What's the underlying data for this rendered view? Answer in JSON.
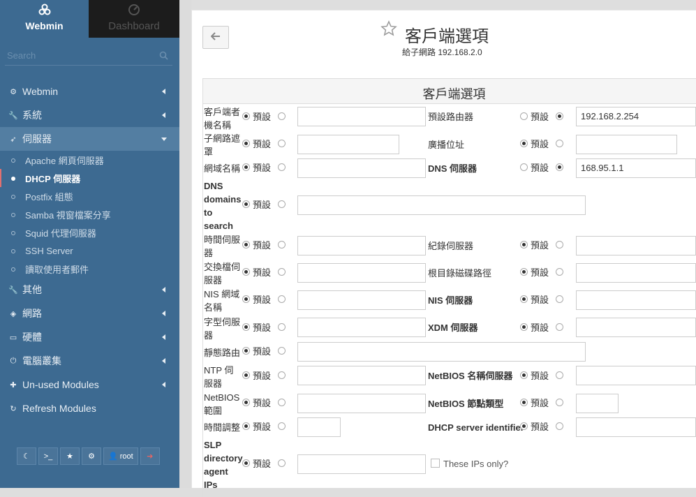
{
  "sidebar": {
    "tab_webmin": "Webmin",
    "tab_dashboard": "Dashboard",
    "search_placeholder": "Search",
    "nav": [
      {
        "label": "Webmin",
        "icon": "gear-icon"
      },
      {
        "label": "系統",
        "icon": "wrench-icon"
      },
      {
        "label": "伺服器",
        "icon": "rocket-icon"
      },
      {
        "label": "其他",
        "icon": "wrench-icon"
      },
      {
        "label": "網路",
        "icon": "shield-icon"
      },
      {
        "label": "硬體",
        "icon": "hdd-icon"
      },
      {
        "label": "電腦叢集",
        "icon": "power-icon"
      },
      {
        "label": "Un-used Modules",
        "icon": "puzzle-icon"
      },
      {
        "label": "Refresh Modules",
        "icon": "refresh-icon"
      }
    ],
    "sub": [
      {
        "label": "Apache 網頁伺服器"
      },
      {
        "label": "DHCP 伺服器"
      },
      {
        "label": "Postfix 組態"
      },
      {
        "label": "Samba 視窗檔案分享"
      },
      {
        "label": "Squid 代理伺服器"
      },
      {
        "label": "SSH Server"
      },
      {
        "label": "讀取使用者郵件"
      }
    ],
    "user": "root"
  },
  "page": {
    "title": "客戶端選項",
    "subtitle": "給子網路 192.168.2.0",
    "panel_title": "客戶端選項"
  },
  "form": {
    "default_label": "預設",
    "client_hostname": "客戶端者機名稱",
    "default_router": "預設路由器",
    "default_router_value": "192.168.2.254",
    "subnet_mask": "子網路遮罩",
    "broadcast": "廣播位址",
    "domain_name": "網域名稱",
    "dns_servers": "DNS 伺服器",
    "dns_servers_value": "168.95.1.1",
    "dns_search": "DNS domains to search",
    "time_servers": "時間伺服器",
    "log_servers": "紀錄伺服器",
    "swap_server": "交換檔伺服器",
    "root_path": "根目錄磁碟路徑",
    "nis_domain": "NIS 網域名稱",
    "nis_servers": "NIS 伺服器",
    "font_servers": "字型伺服器",
    "xdm_servers": "XDM 伺服器",
    "static_routes": "靜態路由",
    "ntp_servers": "NTP 伺服器",
    "netbios_name_servers": "NetBIOS 名稱伺服器",
    "netbios_scope": "NetBIOS 範圍",
    "netbios_node_type": "NetBIOS 節點類型",
    "time_offset": "時間調整",
    "dhcp_server_id": "DHCP server identifier",
    "slp_agent": "SLP directory agent IPs",
    "these_ips_only": "These IPs only?"
  }
}
